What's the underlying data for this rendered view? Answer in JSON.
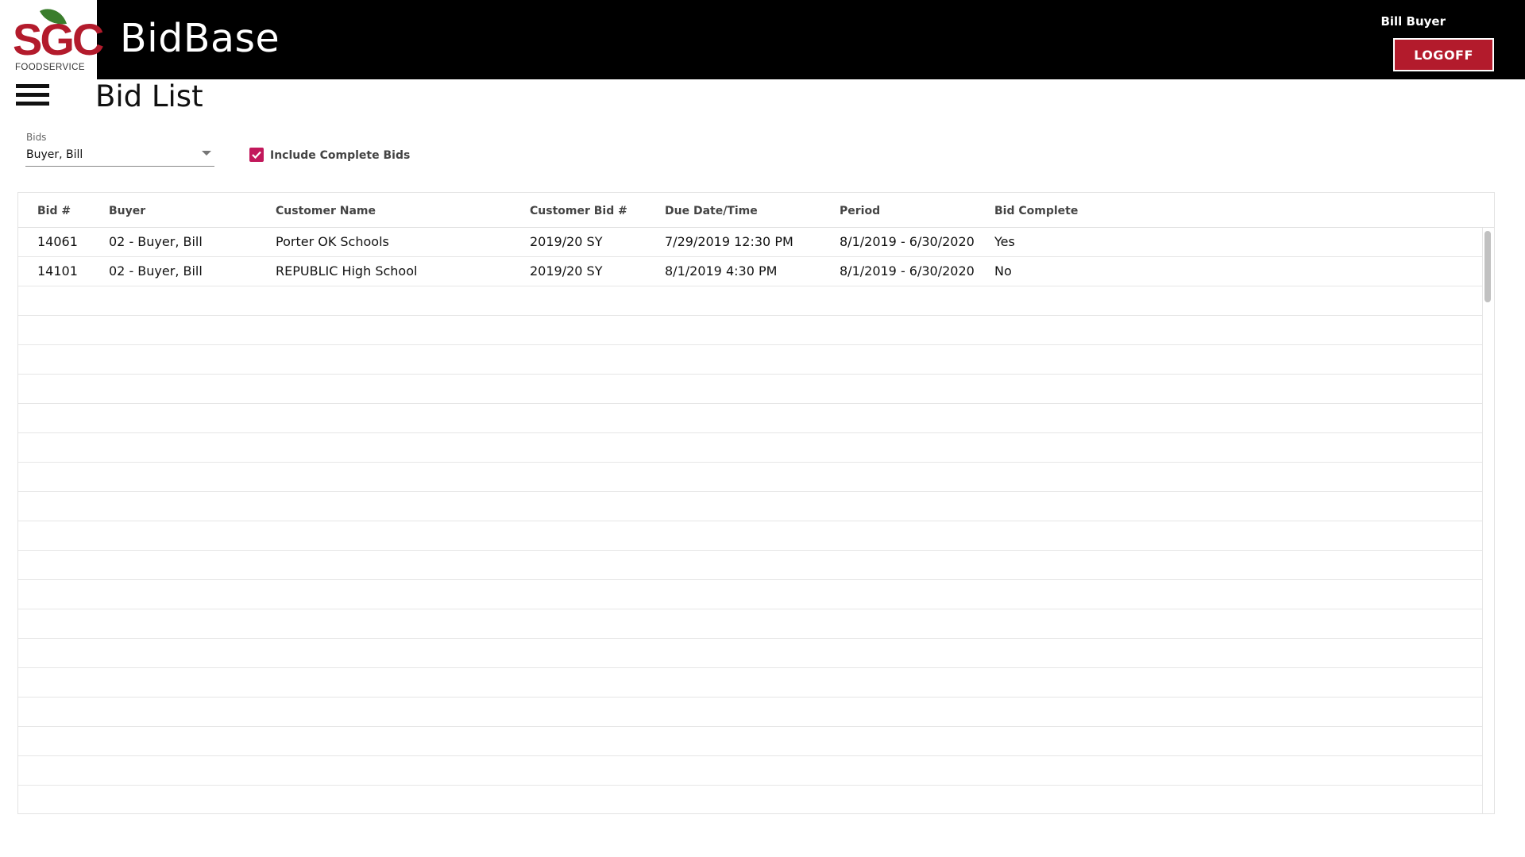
{
  "header": {
    "logo_text": "SGC",
    "logo_subtext": "FOODSERVICE",
    "app_title": "BidBase",
    "user_name": "Bill Buyer",
    "logoff_label": "LOGOFF",
    "accent_color": "#b31b2c"
  },
  "page": {
    "title": "Bid List",
    "menu_icon": "hamburger-menu-icon"
  },
  "filters": {
    "bids_label": "Bids",
    "bids_value": "Buyer, Bill",
    "include_complete_label": "Include Complete Bids",
    "include_complete_checked": true,
    "checkbox_color": "#c2185b"
  },
  "table": {
    "columns": [
      "Bid #",
      "Buyer",
      "Customer Name",
      "Customer Bid #",
      "Due Date/Time",
      "Period",
      "Bid Complete"
    ],
    "rows": [
      [
        "14061",
        "02 - Buyer, Bill",
        "Porter OK Schools",
        "2019/20 SY",
        "7/29/2019 12:30 PM",
        "8/1/2019 - 6/30/2020",
        "Yes"
      ],
      [
        "14101",
        "02 - Buyer, Bill",
        "REPUBLIC High School",
        "2019/20 SY",
        "8/1/2019 4:30 PM",
        "8/1/2019 - 6/30/2020",
        "No"
      ]
    ]
  }
}
